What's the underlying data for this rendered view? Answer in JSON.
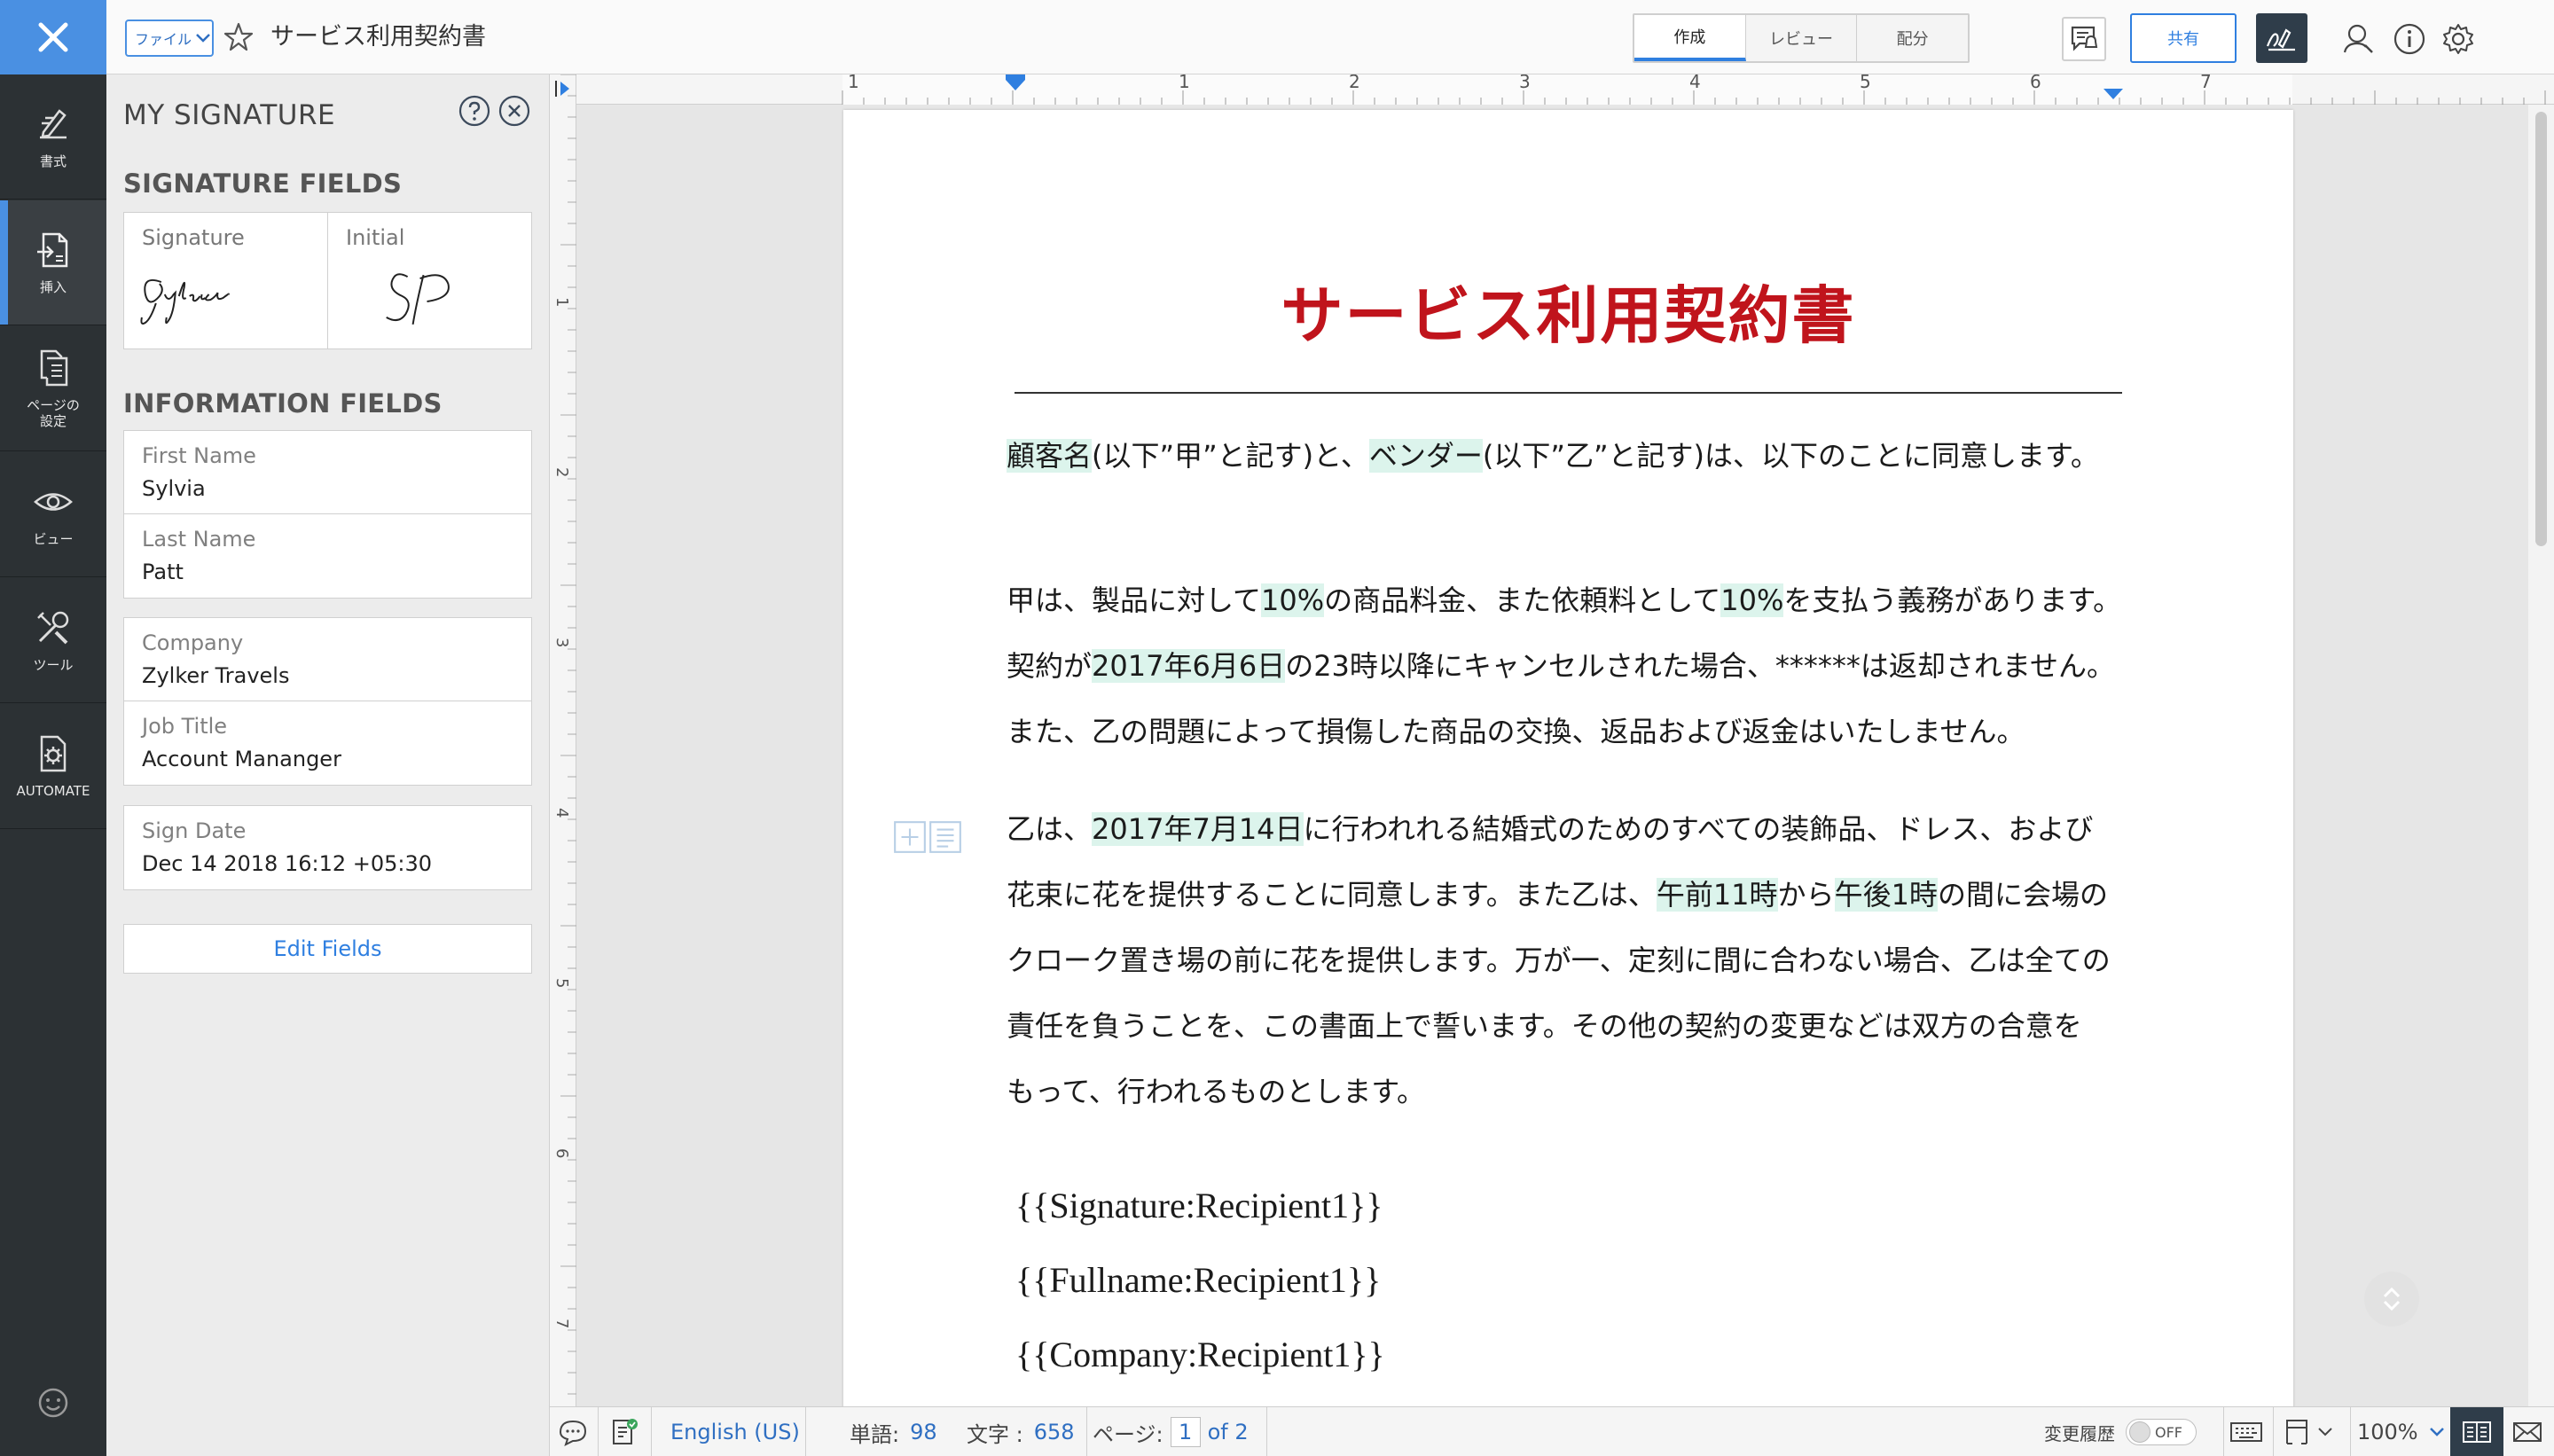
{
  "topbar": {
    "file_label": "ファイル",
    "doc_title": "サービス利用契約書",
    "tabs": [
      "作成",
      "レビュー",
      "配分"
    ],
    "share_label": "共有"
  },
  "rail": {
    "items": [
      "書式",
      "挿入",
      "ページの\n設定",
      "ビュー",
      "ツール",
      "AUTOMATE"
    ]
  },
  "panel": {
    "title": "MY SIGNATURE",
    "sig_section": "SIGNATURE FIELDS",
    "signature_label": "Signature",
    "initial_label": "Initial",
    "info_section": "INFORMATION FIELDS",
    "fields": [
      {
        "label": "First Name",
        "value": "Sylvia"
      },
      {
        "label": "Last Name",
        "value": "Patt"
      },
      {
        "label": "Company",
        "value": "Zylker Travels"
      },
      {
        "label": "Job Title",
        "value": "Account Mananger"
      },
      {
        "label": "Sign Date",
        "value": "Dec 14 2018 16:12 +05:30"
      }
    ],
    "edit_fields": "Edit Fields"
  },
  "ruler": {
    "h_marks": [
      "1",
      "1",
      "2",
      "3",
      "4",
      "5",
      "6",
      "7"
    ],
    "v_marks": [
      "1",
      "2",
      "3",
      "4",
      "5",
      "6",
      "7"
    ]
  },
  "document": {
    "heading": "サービス利用契約書",
    "line1": {
      "hl1": "顧客名",
      "t1": "(以下”甲”と記す)と、",
      "hl2": "ベンダー",
      "t2": "(以下”乙”と記す)は、以下のことに同意します。"
    },
    "line2": {
      "t1": "甲は、製品に対して",
      "hl1": "10%",
      "t2": "の商品料金、また依頼料として",
      "hl2": "10%",
      "t3": "を支払う義務があります。"
    },
    "line3": {
      "t1": "契約が",
      "hl1": "2017年6月6日",
      "t2": "の23時以降にキャンセルされた場合、******は返却されません。"
    },
    "line4": "また、乙の問題によって損傷した商品の交換、返品および返金はいたしません。",
    "line5": {
      "t1": "乙は、",
      "hl1": "2017年7月14日",
      "t2": "に行われれる結婚式のためのすべての装飾品、ドレス、および"
    },
    "line6": {
      "t1": "花束に花を提供することに同意します。また乙は、",
      "hl1": "午前11時",
      "t2": "から",
      "hl2": "午後1時",
      "t3": "の間に会場の"
    },
    "line7": "クローク置き場の前に花を提供します。万が一、定刻に間に合わない場合、乙は全ての",
    "line8": "責任を負うことを、この書面上で誓います。その他の契約の変更などは双方の合意を",
    "line9": "もって、行われるものとします。",
    "placeholders": [
      "{{Signature:Recipient1}}",
      "{{Fullname:Recipient1}}",
      "{{Company:Recipient1}}"
    ]
  },
  "status": {
    "language": "English (US)",
    "words_label": "単語:",
    "words": "98",
    "chars_label": "文字 :",
    "chars": "658",
    "page_label": "ページ:",
    "page_current": "1",
    "page_total": "of 2",
    "history_label": "変更履歴",
    "toggle_state": "OFF",
    "zoom": "100%"
  },
  "colors": {
    "accent": "#2f7fe0",
    "rail_bg": "#2c3134",
    "heading_red": "#c0141c",
    "highlight": "#dcf4ec"
  },
  "icons": [
    "close-icon",
    "format-icon",
    "insert-icon",
    "page-setup-icon",
    "view-icon",
    "tools-icon",
    "automate-icon",
    "feedback-icon",
    "star-icon",
    "notify-icon",
    "sign-icon",
    "user-search-icon",
    "info-icon",
    "gear-icon",
    "help-icon"
  ]
}
